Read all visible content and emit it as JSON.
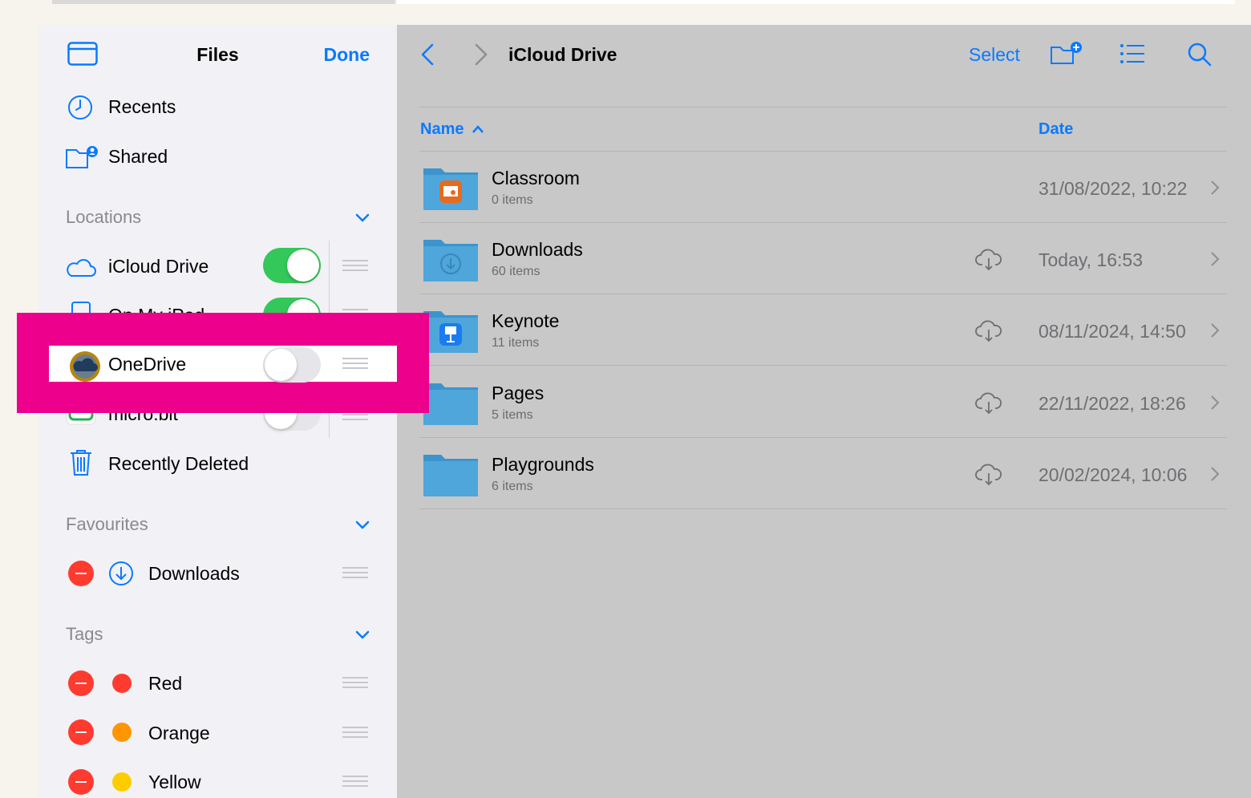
{
  "sidebar": {
    "title": "Files",
    "done_label": "Done",
    "recents_label": "Recents",
    "shared_label": "Shared",
    "locations_header": "Locations",
    "locations": [
      {
        "label": "iCloud Drive",
        "enabled": true
      },
      {
        "label": "On My iPad",
        "enabled": true
      },
      {
        "label": "OneDrive",
        "enabled": false
      },
      {
        "label": "micro:bit",
        "enabled": false
      }
    ],
    "recently_deleted_label": "Recently Deleted",
    "favourites_header": "Favourites",
    "favourites": [
      {
        "label": "Downloads"
      }
    ],
    "tags_header": "Tags",
    "tags": [
      {
        "label": "Red",
        "color": "#ff3b30"
      },
      {
        "label": "Orange",
        "color": "#ff9500"
      },
      {
        "label": "Yellow",
        "color": "#ffcc00"
      }
    ]
  },
  "main": {
    "title": "iCloud Drive",
    "select_label": "Select",
    "columns": {
      "name": "Name",
      "date": "Date"
    },
    "files": [
      {
        "name": "Classroom",
        "count": "0 items",
        "date": "31/08/2022, 10:22",
        "cloud": false
      },
      {
        "name": "Downloads",
        "count": "60 items",
        "date": "Today, 16:53",
        "cloud": true
      },
      {
        "name": "Keynote",
        "count": "11 items",
        "date": "08/11/2024, 14:50",
        "cloud": true
      },
      {
        "name": "Pages",
        "count": "5 items",
        "date": "22/11/2022, 18:26",
        "cloud": true
      },
      {
        "name": "Playgrounds",
        "count": "6 items",
        "date": "20/02/2024, 10:06",
        "cloud": true
      }
    ]
  },
  "colors": {
    "accent": "#0a7aff",
    "highlight": "#ec008c",
    "toggle_on": "#34c759",
    "folder": "#3d94cc"
  }
}
